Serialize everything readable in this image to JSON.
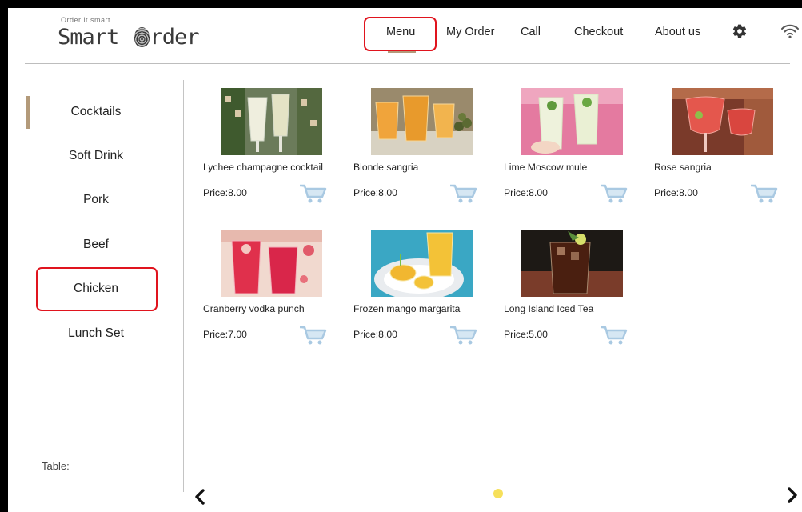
{
  "app": {
    "tagline": "Order it smart",
    "name_prefix": "Smart ",
    "name_suffix": "rder"
  },
  "nav": [
    {
      "label": "Menu",
      "active": true
    },
    {
      "label": "My Order"
    },
    {
      "label": "Call"
    },
    {
      "label": "Checkout"
    },
    {
      "label": "About us"
    }
  ],
  "icons": [
    "gear-icon",
    "wifi-icon",
    "cart-icon",
    "chevron-left-icon",
    "chevron-right-icon"
  ],
  "categories": [
    {
      "label": "Cocktails",
      "active": true
    },
    {
      "label": "Soft Drink"
    },
    {
      "label": "Pork"
    },
    {
      "label": "Beef"
    },
    {
      "label": "Chicken",
      "highlighted": true
    },
    {
      "label": "Lunch Set"
    }
  ],
  "table_label": "Table:",
  "products": [
    {
      "name": "Lychee champagne cocktail",
      "price": "Price:8.00"
    },
    {
      "name": "Blonde sangria",
      "price": "Price:8.00"
    },
    {
      "name": "Lime Moscow mule",
      "price": "Price:8.00"
    },
    {
      "name": "Rose sangria",
      "price": "Price:8.00"
    },
    {
      "name": "Cranberry vodka punch",
      "price": "Price:7.00"
    },
    {
      "name": "Frozen mango margarita",
      "price": "Price:8.00"
    },
    {
      "name": "Long Island Iced Tea",
      "price": "Price:5.00"
    }
  ],
  "colors": {
    "accent": "#b39a7a",
    "highlight": "#e0141e",
    "cart": "#a9c9e2",
    "page_dot": "#f6e05b"
  },
  "pagination": {
    "current_page": 1
  }
}
